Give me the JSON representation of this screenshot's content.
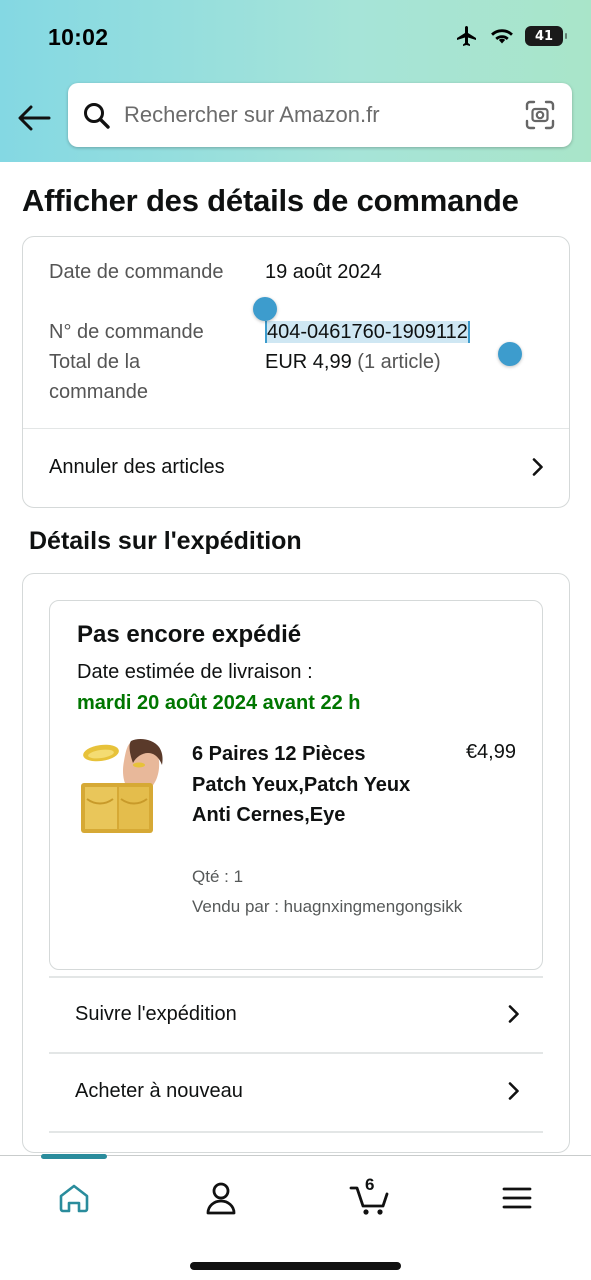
{
  "status_bar": {
    "time": "10:02",
    "battery": "41"
  },
  "header": {
    "search_placeholder": "Rechercher sur Amazon.fr"
  },
  "page_title": "Afficher des détails de commande",
  "order_summary": {
    "date_label": "Date de commande",
    "date_value": "19 août 2024",
    "number_label": "N° de commande",
    "number_value": "404-0461760-1909112",
    "total_label": "Total de la commande",
    "total_value": "EUR 4,99",
    "total_items": "(1 article)",
    "cancel_label": "Annuler des articles"
  },
  "shipment_section": {
    "title": "Détails sur l'expédition",
    "status": "Pas encore expédié",
    "estimated_label": "Date estimée de livraison :",
    "estimated_date": "mardi 20 août 2024 avant 22 h",
    "product": {
      "title": "6 Paires 12 Pièces Patch Yeux,Patch Yeux Anti Cernes,Eye",
      "price": "€4,99",
      "quantity": "Qté : 1",
      "seller": "Vendu par : huagnxingmengongsikk"
    },
    "track_label": "Suivre l'expédition",
    "buy_again_label": "Acheter à nouveau"
  },
  "bottom_nav": {
    "items": [
      {
        "icon": "home-icon",
        "active": true
      },
      {
        "icon": "account-icon",
        "active": false
      },
      {
        "icon": "cart-icon",
        "active": false
      },
      {
        "icon": "menu-icon",
        "active": false
      }
    ],
    "cart_count": "6",
    "active_color": "#2a8c9c"
  },
  "colors": {
    "delivery_green": "#007600",
    "selection_blue": "#3d9ccd"
  }
}
